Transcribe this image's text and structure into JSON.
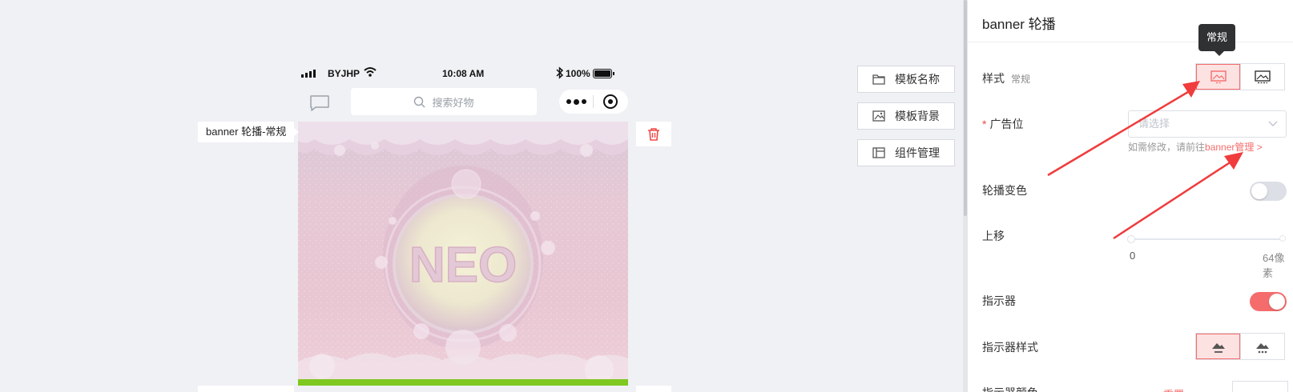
{
  "phone": {
    "carrier": "BYJHP",
    "time": "10:08 AM",
    "battery": "100%",
    "search_placeholder": "搜索好物",
    "banner_text": "NEO"
  },
  "canvas": {
    "component_label": "banner 轮播-常规"
  },
  "side_buttons": {
    "template_name": "模板名称",
    "template_bg": "模板背景",
    "component_mgmt": "组件管理"
  },
  "panel": {
    "title": "banner 轮播",
    "tooltip": "常规",
    "style_label": "样式",
    "style_value": "常规",
    "ad_slot_label": "广告位",
    "ad_slot_required": "*",
    "ad_slot_placeholder": "请选择",
    "hint_prefix": "如需修改，请前往",
    "hint_link": "banner管理 >",
    "carousel_color_label": "轮播变色",
    "carousel_color_on": false,
    "move_up_label": "上移",
    "move_up_min": "0",
    "move_up_max": "64像素",
    "move_up_value": 0,
    "indicator_label": "指示器",
    "indicator_on": true,
    "indicator_style_label": "指示器样式",
    "indicator_color_label": "指示器颜色",
    "reset_label": "重置",
    "accent_color": "#f56c6c"
  }
}
